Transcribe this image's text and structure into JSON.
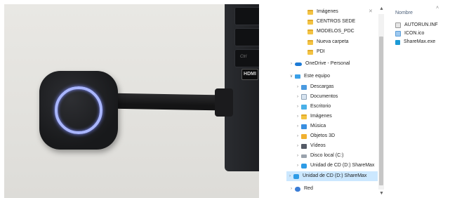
{
  "photo": {
    "hdmi_label": "HDMI",
    "keys": [
      "",
      "",
      "Ctrl"
    ]
  },
  "explorer": {
    "nav_items": [
      {
        "label": "Imágenes",
        "icon": "pictures-folder-icon",
        "indent": 2,
        "chevron": ""
      },
      {
        "label": "CENTROS SEDE",
        "icon": "folder-icon",
        "indent": 2,
        "chevron": ""
      },
      {
        "label": "MODELOS_PDC",
        "icon": "folder-icon",
        "indent": 2,
        "chevron": ""
      },
      {
        "label": "Nueva carpeta",
        "icon": "folder-icon",
        "indent": 2,
        "chevron": ""
      },
      {
        "label": "PDI",
        "icon": "folder-icon",
        "indent": 2,
        "chevron": ""
      },
      {
        "label": "OneDrive - Personal",
        "icon": "onedrive-icon",
        "indent": 0,
        "chevron": ">"
      },
      {
        "label": "Este equipo",
        "icon": "this-pc-icon",
        "indent": 0,
        "chevron": "v"
      },
      {
        "label": "Descargas",
        "icon": "downloads-folder-icon",
        "indent": 1,
        "chevron": ">"
      },
      {
        "label": "Documentos",
        "icon": "documents-folder-icon",
        "indent": 1,
        "chevron": ">"
      },
      {
        "label": "Escritorio",
        "icon": "desktop-folder-icon",
        "indent": 1,
        "chevron": ">"
      },
      {
        "label": "Imágenes",
        "icon": "pictures-folder-icon",
        "indent": 1,
        "chevron": ">"
      },
      {
        "label": "Música",
        "icon": "music-folder-icon",
        "indent": 1,
        "chevron": ">"
      },
      {
        "label": "Objetos 3D",
        "icon": "3d-objects-folder-icon",
        "indent": 1,
        "chevron": ">"
      },
      {
        "label": "Vídeos",
        "icon": "videos-folder-icon",
        "indent": 1,
        "chevron": ">"
      },
      {
        "label": "Disco local (C:)",
        "icon": "local-disk-icon",
        "indent": 1,
        "chevron": ">"
      },
      {
        "label": "Unidad de CD (D:) ShareMax",
        "icon": "cd-drive-icon",
        "indent": 1,
        "chevron": ">"
      },
      {
        "label": "Unidad de CD (D:) ShareMax",
        "icon": "cd-drive-icon",
        "indent": 0,
        "chevron": ">",
        "selected": true
      },
      {
        "label": "Red",
        "icon": "network-icon",
        "indent": 0,
        "chevron": ">"
      }
    ],
    "column_header": "Nombre",
    "files": [
      {
        "name": "AUTORUN.INF",
        "icon": "inf-file-icon"
      },
      {
        "name": "ICON.ico",
        "icon": "ico-file-icon"
      },
      {
        "name": "ShareMax.exe",
        "icon": "sharemax-exe-icon"
      }
    ],
    "selection_color": "#cce8ff",
    "header_color": "#4c607a"
  }
}
